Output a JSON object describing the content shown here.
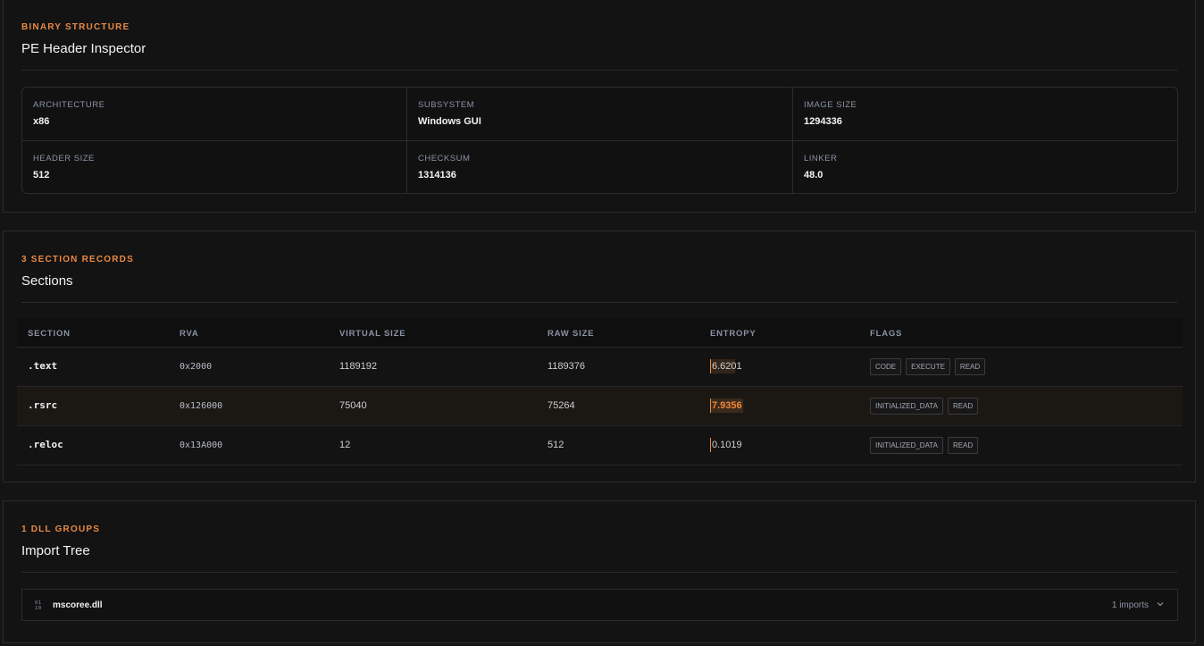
{
  "header_panel": {
    "eyebrow": "BINARY STRUCTURE",
    "title": "PE Header Inspector",
    "fields": [
      {
        "label": "ARCHITECTURE",
        "value": "x86"
      },
      {
        "label": "SUBSYSTEM",
        "value": "Windows GUI"
      },
      {
        "label": "IMAGE SIZE",
        "value": "1294336"
      },
      {
        "label": "HEADER SIZE",
        "value": "512"
      },
      {
        "label": "CHECKSUM",
        "value": "1314136"
      },
      {
        "label": "LINKER",
        "value": "48.0"
      }
    ]
  },
  "sections_panel": {
    "eyebrow": "3 SECTION RECORDS",
    "title": "Sections",
    "columns": [
      "SECTION",
      "RVA",
      "VIRTUAL SIZE",
      "RAW SIZE",
      "ENTROPY",
      "FLAGS"
    ],
    "rows": [
      {
        "name": ".text",
        "rva": "0x2000",
        "virtual_size": "1189192",
        "raw_size": "1189376",
        "entropy": "6.6201",
        "entropy_fraction": 0.8275,
        "flags": [
          "CODE",
          "EXECUTE",
          "READ"
        ]
      },
      {
        "name": ".rsrc",
        "rva": "0x126000",
        "virtual_size": "75040",
        "raw_size": "75264",
        "entropy": "7.9356",
        "entropy_fraction": 0.992,
        "flags": [
          "INITIALIZED_DATA",
          "READ"
        ]
      },
      {
        "name": ".reloc",
        "rva": "0x13A000",
        "virtual_size": "12",
        "raw_size": "512",
        "entropy": "0.1019",
        "entropy_fraction": 0.0127,
        "flags": [
          "INITIALIZED_DATA",
          "READ"
        ]
      }
    ]
  },
  "imports_panel": {
    "eyebrow": "1 DLL GROUPS",
    "title": "Import Tree",
    "groups": [
      {
        "dll": "mscoree.dll",
        "count_label": "1 imports"
      }
    ]
  },
  "colors": {
    "accent": "#e98a44",
    "background": "#141414",
    "border": "#2c2c2c"
  },
  "icons": {
    "dll": "binary-icon",
    "expand": "chevron-down-icon"
  }
}
